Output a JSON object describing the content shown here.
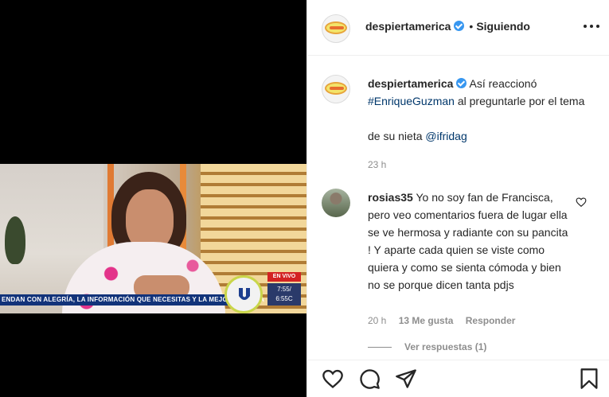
{
  "post": {
    "username": "despiertamerica",
    "follow_status": "Siguiendo",
    "more_label": "•••",
    "dot": "•"
  },
  "media": {
    "ticker": "ENDAN CON ALEGRÍA, LA INFORMACIÓN QUE NECESITAS Y LA MEJOR ENERGÍA",
    "live_badge": "EN VIVO",
    "clock_line1": "7:55/",
    "clock_line2": "6:55C"
  },
  "caption": {
    "username": "despiertamerica",
    "text1": "Así reaccionó",
    "hashtag": "#EnriqueGuzman",
    "text2": "al preguntarle por el tema",
    "text3": "de su nieta",
    "mention": "@ifridag",
    "time": "23 h"
  },
  "comment": {
    "username": "rosias35",
    "text": "Yo no soy fan de Francisca, pero veo comentarios fuera de lugar ella se ve hermosa y radiante con su pancita ! Y aparte cada quien se viste como quiera y como se sienta cómoda y bien no se porque dicen tanta pdjs",
    "time": "20 h",
    "likes": "13 Me gusta",
    "reply": "Responder",
    "view_replies": "Ver respuestas (1)"
  },
  "colors": {
    "link": "#00376b",
    "verified": "#3897f0",
    "muted": "#8e8e8e"
  }
}
